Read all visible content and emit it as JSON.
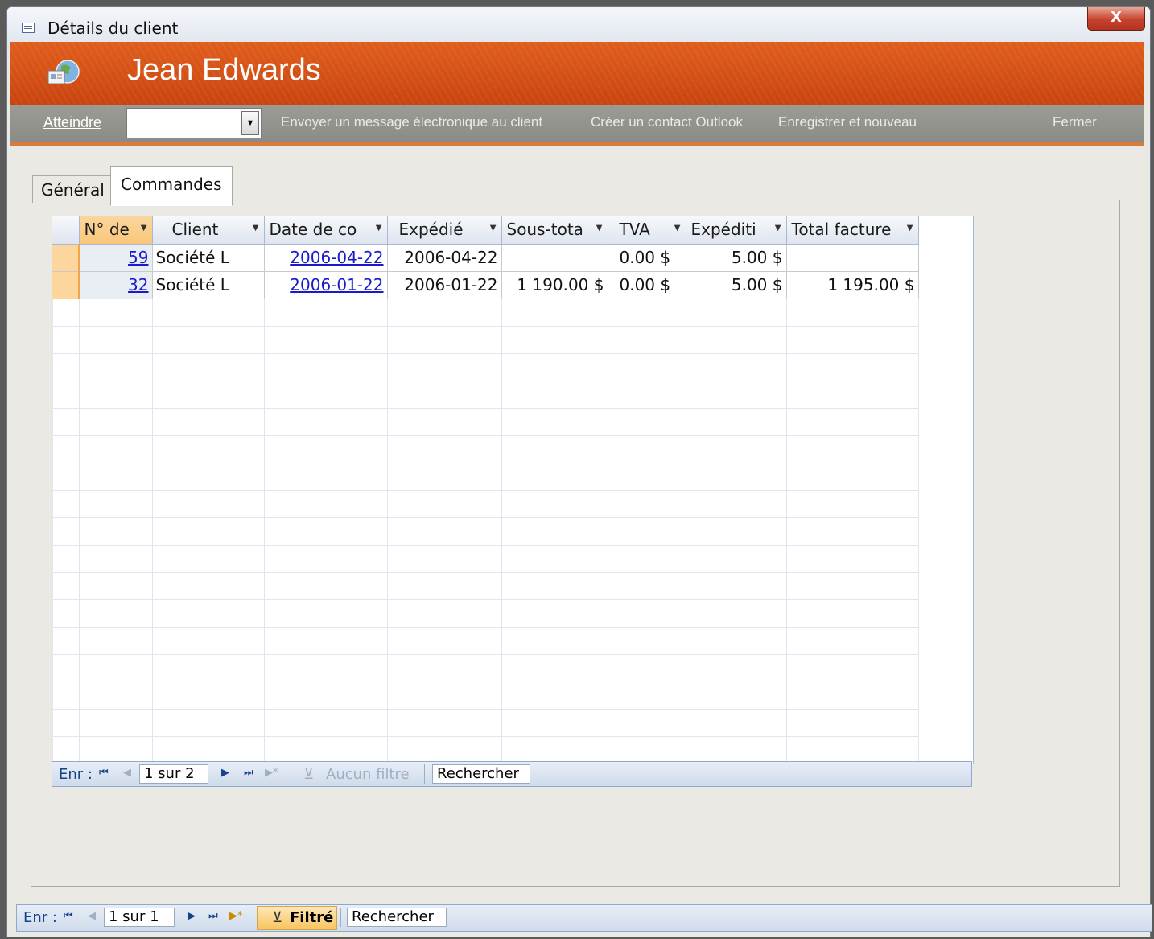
{
  "window": {
    "title": "Détails du client",
    "close_label": "X"
  },
  "header": {
    "name": "Jean Edwards"
  },
  "cmdbar": {
    "goto_label": "Atteindre",
    "goto_value": "",
    "email_label": "Envoyer un message électronique au client",
    "outlook_label": "Créer un contact Outlook",
    "save_new_label": "Enregistrer et nouveau",
    "close_label": "Fermer"
  },
  "tabs": [
    {
      "label": "Général",
      "active": false
    },
    {
      "label": "Commandes",
      "active": true
    }
  ],
  "sheet": {
    "columns": [
      "N° de",
      "Client",
      "Date de co",
      "Expédié",
      "Sous-tota",
      "TVA",
      "Expéditi",
      "Total facture"
    ],
    "rows": [
      {
        "id": "59",
        "client": "Société L",
        "date": "2006-04-22",
        "shipped": "2006-04-22",
        "subtotal": "",
        "tva": "0.00 $",
        "shipping": "5.00 $",
        "total": ""
      },
      {
        "id": "32",
        "client": "Société L",
        "date": "2006-01-22",
        "shipped": "2006-01-22",
        "subtotal": "1 190.00 $",
        "tva": "0.00 $",
        "shipping": "5.00 $",
        "total": "1 195.00 $"
      }
    ]
  },
  "subnav": {
    "label": "Enr :",
    "record": "1 sur 2",
    "filter_label": "Aucun filtre",
    "search_label": "Rechercher"
  },
  "mainnav": {
    "label": "Enr :",
    "record": "1 sur 1",
    "filter_label": "Filtré",
    "search_label": "Rechercher"
  },
  "colors": {
    "header_orange": "#d4521a",
    "link_blue": "#1a1acc",
    "selection": "#fcd69c"
  }
}
